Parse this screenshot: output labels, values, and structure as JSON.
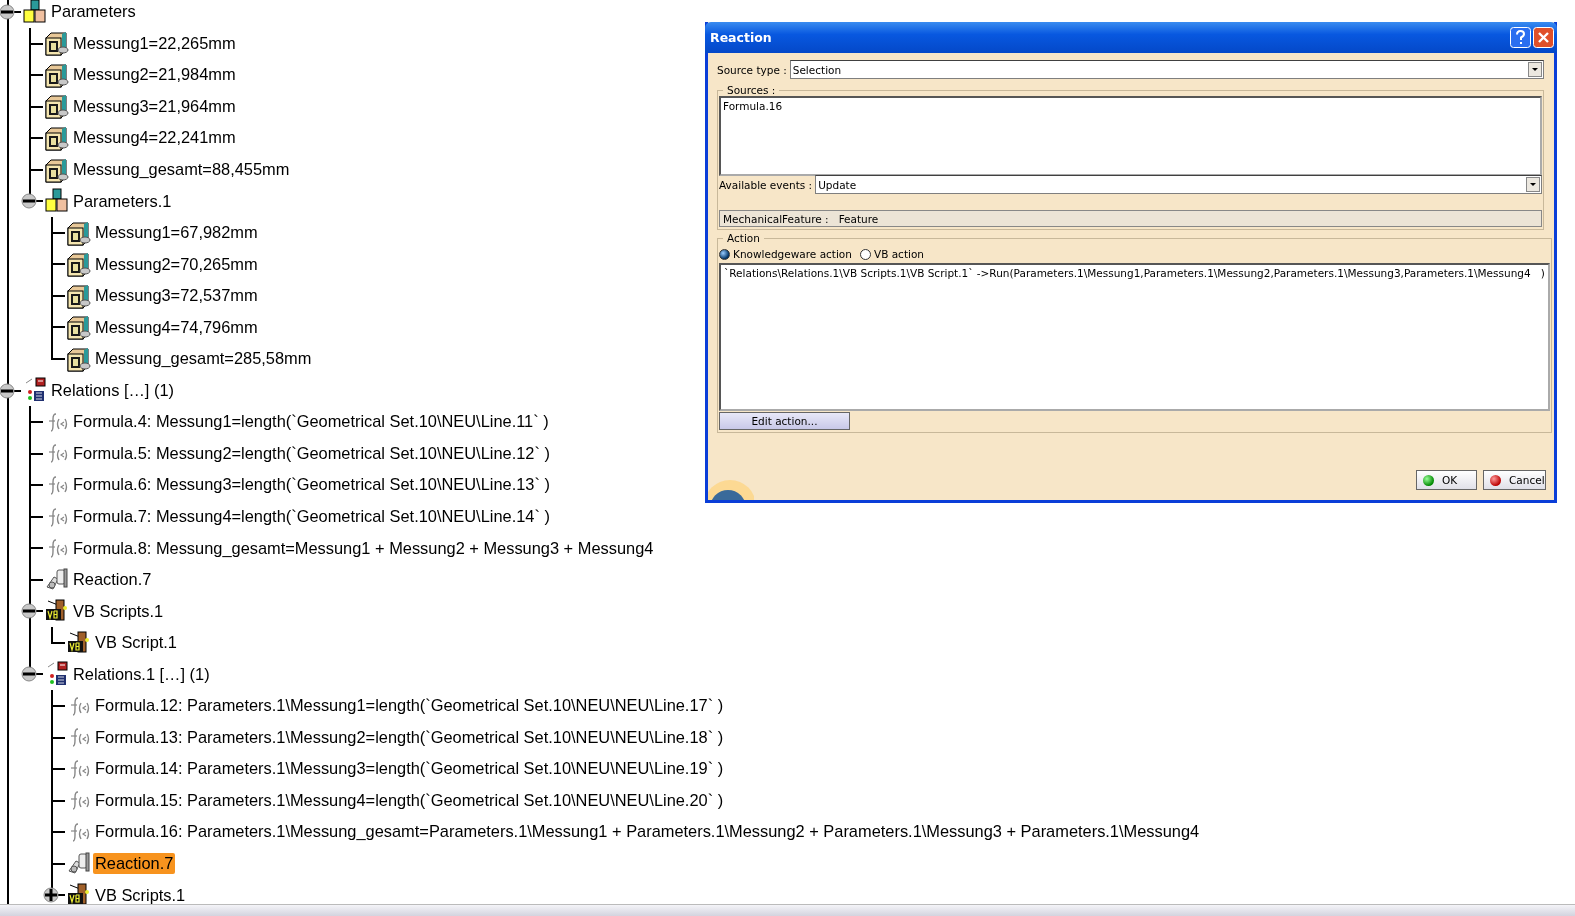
{
  "tree": [
    {
      "kind": "param-set",
      "label": "Parameters",
      "expanded": true,
      "children": [
        {
          "kind": "param",
          "label": "Messung1=22,265mm"
        },
        {
          "kind": "param",
          "label": "Messung2=21,984mm"
        },
        {
          "kind": "param",
          "label": "Messung3=21,964mm"
        },
        {
          "kind": "param",
          "label": "Messung4=22,241mm"
        },
        {
          "kind": "param",
          "label": "Messung_gesamt=88,455mm"
        },
        {
          "kind": "param-set",
          "label": "Parameters.1",
          "expanded": true,
          "children": [
            {
              "kind": "param",
              "label": "Messung1=67,982mm"
            },
            {
              "kind": "param",
              "label": "Messung2=70,265mm"
            },
            {
              "kind": "param",
              "label": "Messung3=72,537mm"
            },
            {
              "kind": "param",
              "label": "Messung4=74,796mm"
            },
            {
              "kind": "param",
              "label": "Messung_gesamt=285,58mm"
            }
          ]
        }
      ]
    },
    {
      "kind": "relations",
      "label": "Relations […] (1)",
      "expanded": true,
      "children": [
        {
          "kind": "formula",
          "label": "Formula.4: Messung1=length(`Geometrical Set.10\\NEU\\Line.11` )"
        },
        {
          "kind": "formula",
          "label": "Formula.5: Messung2=length(`Geometrical Set.10\\NEU\\Line.12` )"
        },
        {
          "kind": "formula",
          "label": "Formula.6: Messung3=length(`Geometrical Set.10\\NEU\\Line.13` )"
        },
        {
          "kind": "formula",
          "label": "Formula.7: Messung4=length(`Geometrical Set.10\\NEU\\Line.14` )"
        },
        {
          "kind": "formula",
          "label": "Formula.8: Messung_gesamt=Messung1 + Messung2 + Messung3 + Messung4"
        },
        {
          "kind": "reaction",
          "label": "Reaction.7",
          "selected": false
        },
        {
          "kind": "vb-scripts",
          "label": "VB Scripts.1",
          "expanded": true,
          "children": [
            {
              "kind": "vb-script",
              "label": "VB Script.1"
            }
          ]
        },
        {
          "kind": "relations",
          "label": "Relations.1 […] (1)",
          "expanded": true,
          "children": [
            {
              "kind": "formula",
              "label": "Formula.12: Parameters.1\\Messung1=length(`Geometrical Set.10\\NEU\\NEU\\Line.17` )"
            },
            {
              "kind": "formula",
              "label": "Formula.13: Parameters.1\\Messung2=length(`Geometrical Set.10\\NEU\\NEU\\Line.18` )"
            },
            {
              "kind": "formula",
              "label": "Formula.14: Parameters.1\\Messung3=length(`Geometrical Set.10\\NEU\\NEU\\Line.19` )"
            },
            {
              "kind": "formula",
              "label": "Formula.15: Parameters.1\\Messung4=length(`Geometrical Set.10\\NEU\\NEU\\Line.20` )"
            },
            {
              "kind": "formula",
              "label": "Formula.16: Parameters.1\\Messung_gesamt=Parameters.1\\Messung1 + Parameters.1\\Messung2 + Parameters.1\\Messung3 + Parameters.1\\Messung4"
            },
            {
              "kind": "reaction",
              "label": "Reaction.7",
              "selected": true
            },
            {
              "kind": "vb-scripts",
              "label": "VB Scripts.1",
              "expanded": false
            }
          ]
        }
      ]
    }
  ],
  "dialog": {
    "title": "Reaction",
    "source_type": {
      "label": "Source type :",
      "value": "Selection"
    },
    "sources": {
      "label": "Sources :",
      "items": [
        "Formula.16"
      ]
    },
    "available_events": {
      "label": "Available events :",
      "value": "Update"
    },
    "feature": {
      "label": "MechanicalFeature :",
      "value": "Feature"
    },
    "action": {
      "label": "Action",
      "options": [
        {
          "label": "Knowledgeware action",
          "selected": true
        },
        {
          "label": "VB action",
          "selected": false
        }
      ],
      "code": "`Relations\\Relations.1\\VB Scripts.1\\VB Script.1` ->Run(Parameters.1\\Messung1,Parameters.1\\Messung2,Parameters.1\\Messung3,Parameters.1\\Messung4   )",
      "edit_button": "Edit action..."
    },
    "buttons": [
      {
        "kind": "ok",
        "label": "OK"
      },
      {
        "kind": "cancel",
        "label": "Cancel"
      }
    ]
  }
}
